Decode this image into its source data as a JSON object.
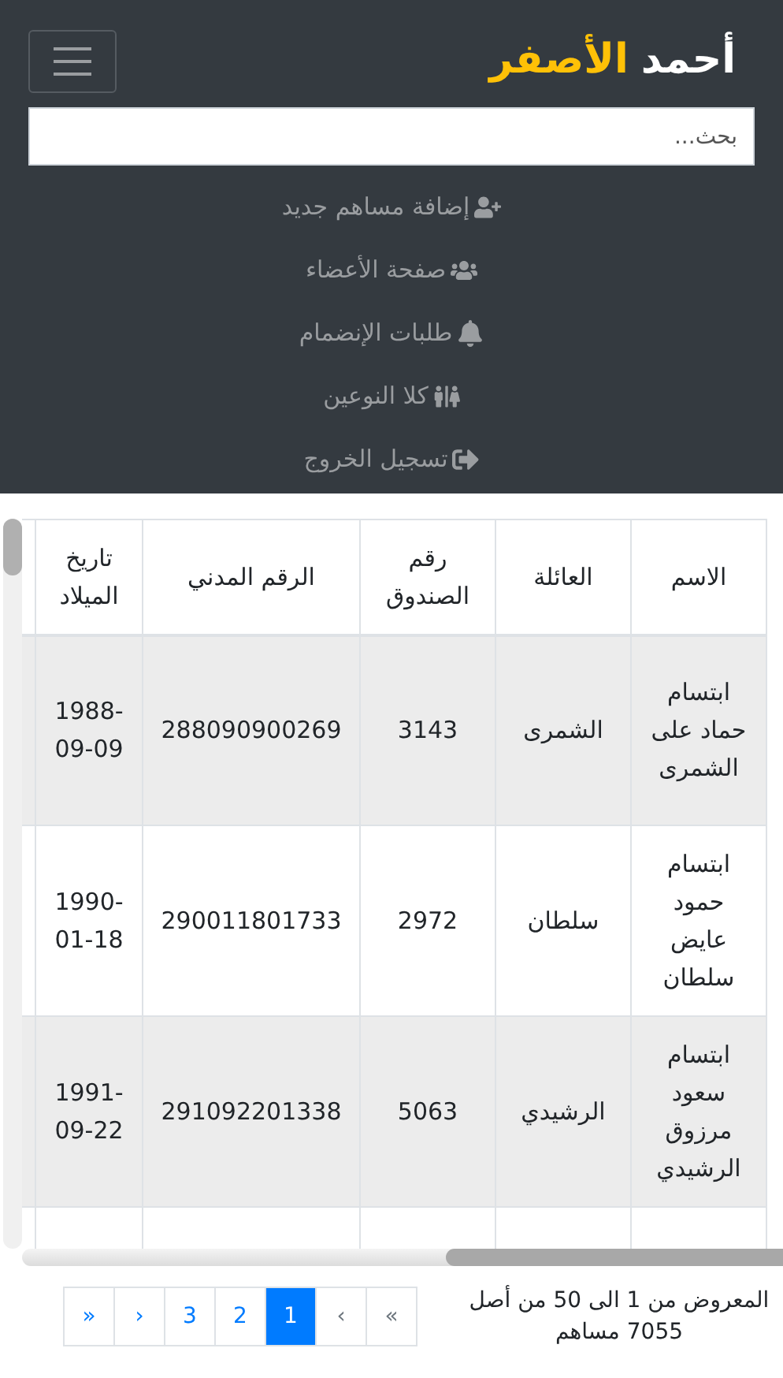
{
  "brand": {
    "first": "أحمد",
    "second": "الأصفر"
  },
  "search": {
    "placeholder": "بحث..."
  },
  "menu": [
    {
      "label": "إضافة مساهم جديد",
      "kind": "add-user"
    },
    {
      "label": "صفحة الأعضاء",
      "kind": "members"
    },
    {
      "label": "طلبات الإنضمام",
      "kind": "bell"
    },
    {
      "label": "كلا النوعين",
      "kind": "both"
    },
    {
      "label": "تسجيل الخروج",
      "kind": "logout"
    }
  ],
  "table": {
    "columns": [
      "الاسم",
      "العائلة",
      "رقم الصندوق",
      "الرقم المدني",
      "تاريخ الميلاد"
    ],
    "rows": [
      {
        "cells": [
          "ابتسام حماد على الشمرى",
          "الشمرى",
          "3143",
          "288090900269",
          "1988-09-09"
        ]
      },
      {
        "cells": [
          "ابتسام حمود عايض سلطان",
          "سلطان",
          "2972",
          "290011801733",
          "1990-01-18"
        ]
      },
      {
        "cells": [
          "ابتسام سعود مرزوق الرشيدي",
          "الرشيدي",
          "5063",
          "291092201338",
          "1991-09-22"
        ]
      }
    ]
  },
  "summary": "المعروض من 1 الى 50 من أصل 7055 مساهم",
  "pagination": [
    {
      "label": "«",
      "selected": false,
      "disabled": true
    },
    {
      "label": "‹",
      "selected": false,
      "disabled": true
    },
    {
      "label": "1",
      "selected": true,
      "disabled": false
    },
    {
      "label": "2",
      "selected": false,
      "disabled": false
    },
    {
      "label": "3",
      "selected": false,
      "disabled": false
    },
    {
      "label": "›",
      "selected": false,
      "disabled": false
    },
    {
      "label": "»",
      "selected": false,
      "disabled": false
    }
  ]
}
